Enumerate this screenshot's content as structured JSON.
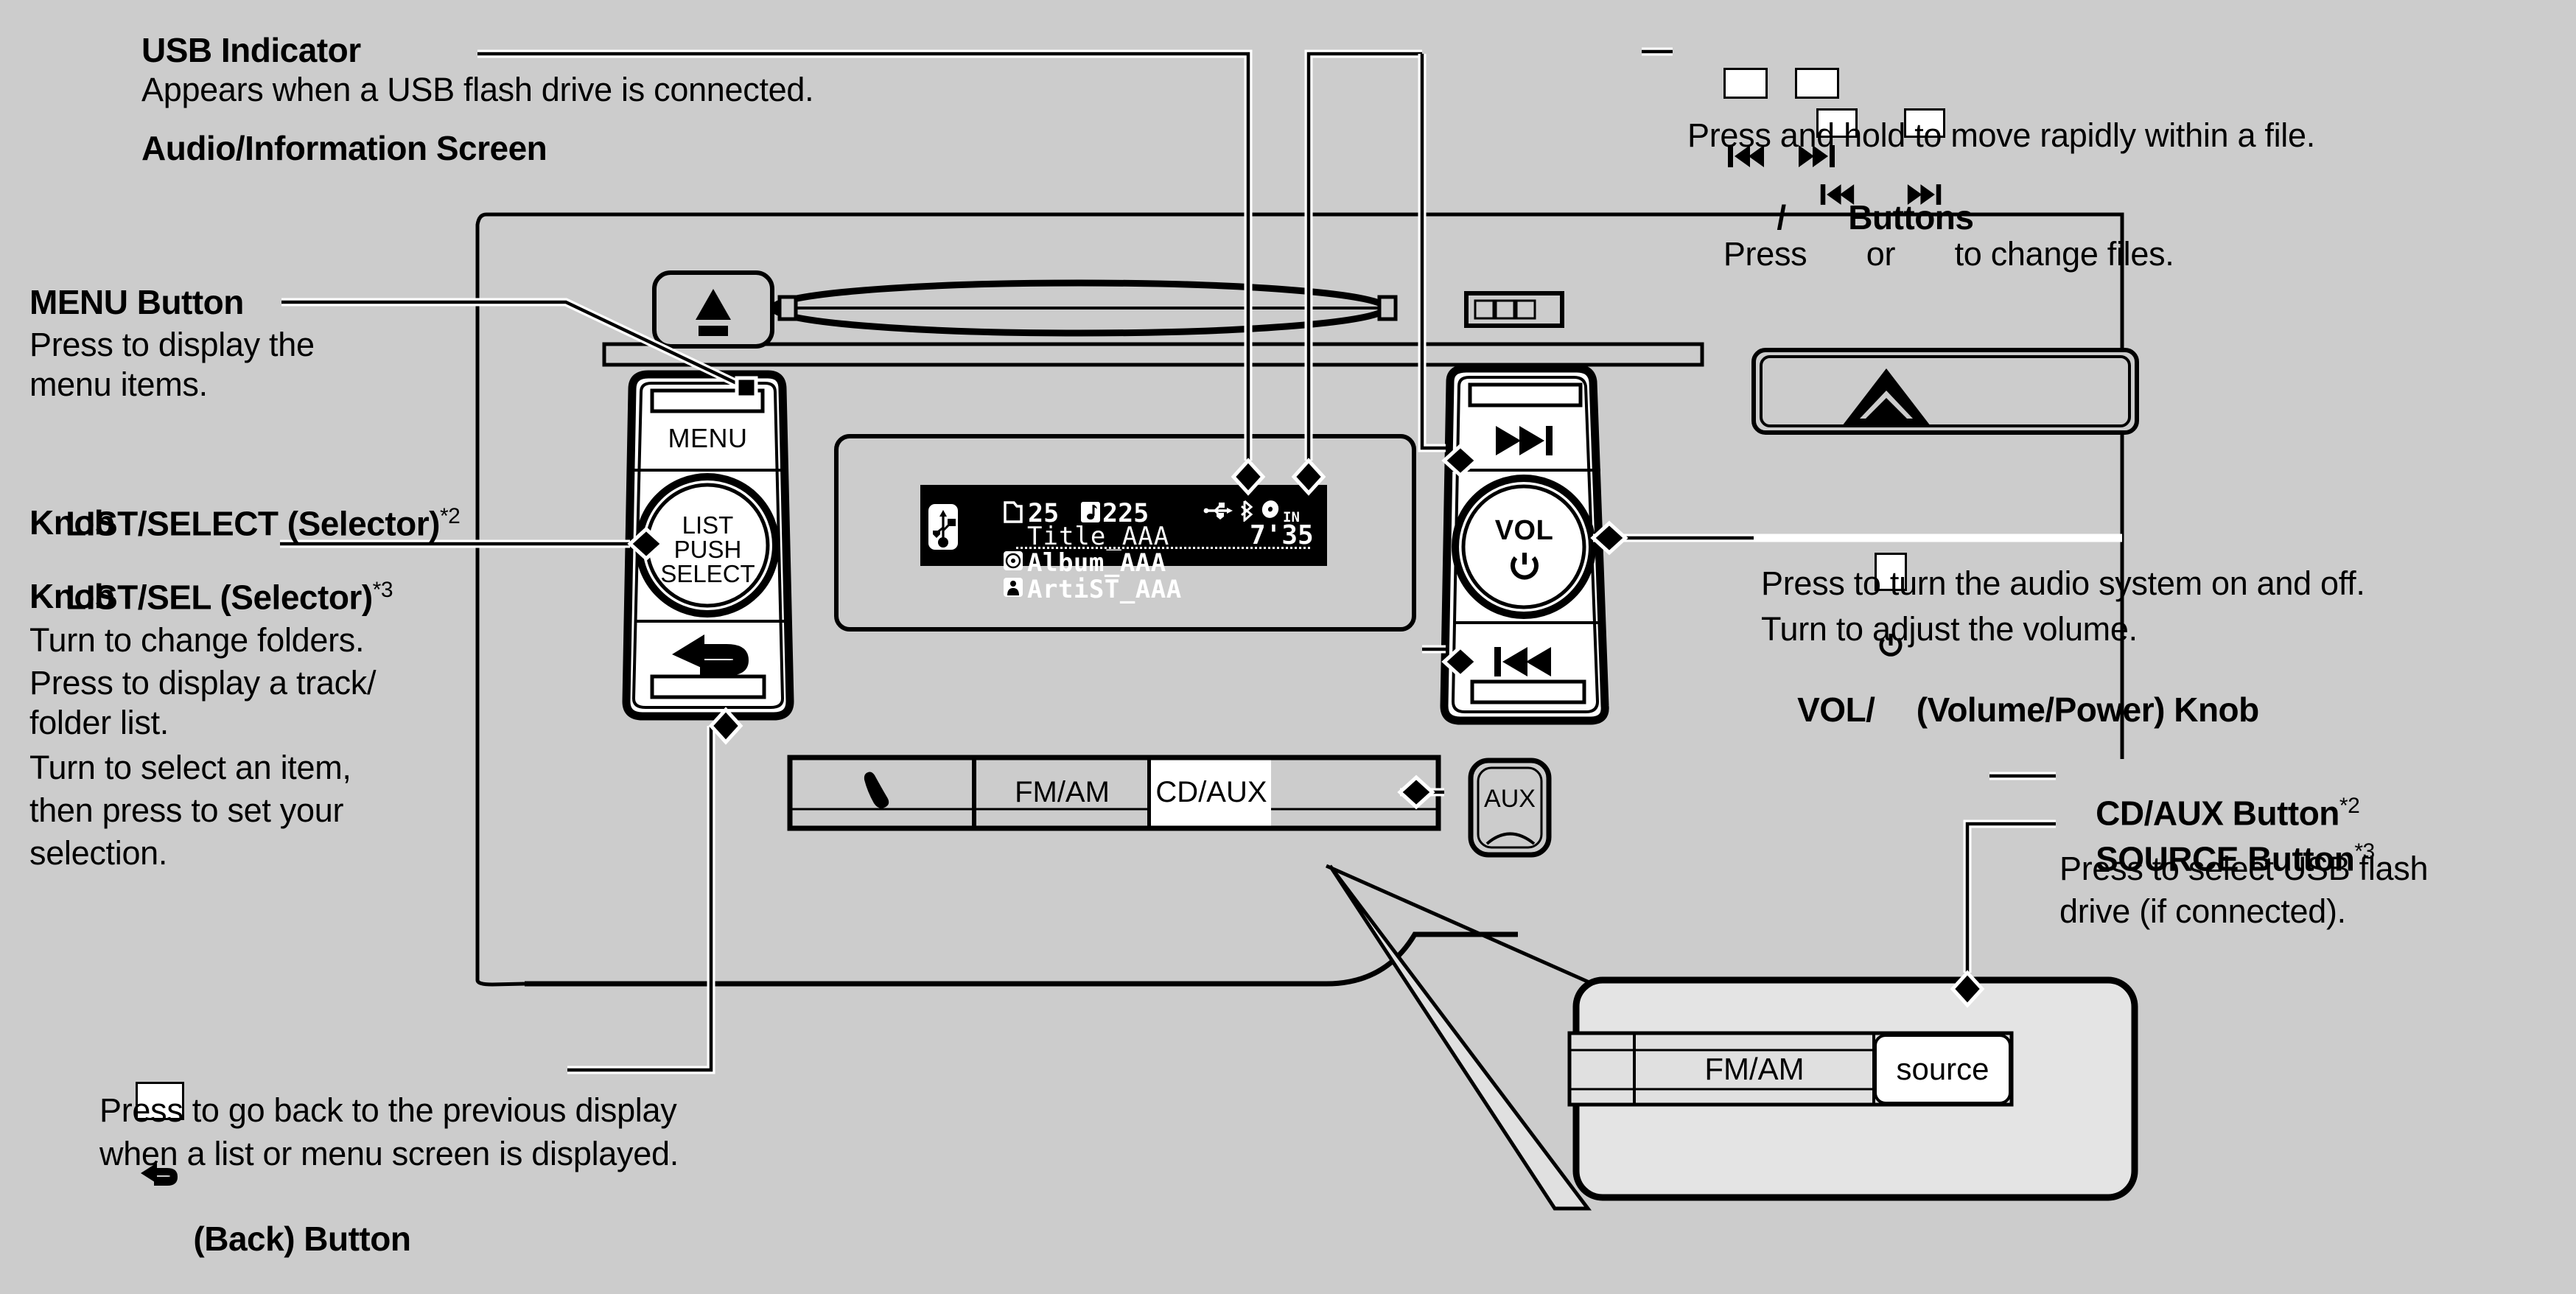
{
  "background_color": "#cccccc",
  "callouts": [
    {
      "id": "usb-indicator",
      "title": "USB Indicator",
      "lines": [
        "Appears when a USB flash drive is connected."
      ]
    },
    {
      "id": "audio-information-screen",
      "title": "Audio/Information Screen",
      "lines": []
    },
    {
      "id": "skip-buttons",
      "title_prefix": "",
      "title_mid": " / ",
      "title_suffix": " Buttons",
      "line1_a": "Press ",
      "line1_b": " or ",
      "line1_c": " to change files.",
      "line2": "Press and hold to move rapidly within a file."
    },
    {
      "id": "menu-button",
      "title": "MENU Button",
      "lines": [
        "Press to display the",
        "menu items."
      ]
    },
    {
      "id": "list-select-knob",
      "title1": "LIST/SELECT (Selector)",
      "title1_sup": "*2",
      "title1_b": "Knob",
      "title2": "LIST/SEL (Selector)",
      "title2_sup": "*3",
      "title2_b": "Knob",
      "lines": [
        "Turn to change folders.",
        "Press to display a track/",
        "folder list.",
        "Turn to select an item,",
        "then press to set your",
        "selection."
      ]
    },
    {
      "id": "back-button",
      "title_suffix": " (Back) Button",
      "lines": [
        "Press to go back to the previous display",
        "when a list or menu screen is displayed."
      ]
    },
    {
      "id": "vol-power-knob",
      "title_a": "VOL/",
      "title_b": " (Volume/Power) Knob",
      "lines": [
        "Press to turn the audio system on and off.",
        "Turn to adjust the volume."
      ]
    },
    {
      "id": "cd-aux-source-button",
      "title1": "CD/AUX Button",
      "title1_sup": "*2",
      "title2": "SOURCE Button",
      "title2_sup": "*3",
      "lines": [
        "Press to select USB flash",
        "drive (if connected)."
      ]
    }
  ],
  "head_unit": {
    "eject_button_icon": "eject-icon",
    "cd_slot": "cd-slot",
    "vent_grille": "vent-grille",
    "hazard_button_icon": "hazard-triangle-icon",
    "left_knob_panel": {
      "menu_label": "MENU",
      "knob_line1": "LIST",
      "knob_line2": "PUSH",
      "knob_line3": "SELECT",
      "back_icon": "back-arrow-icon"
    },
    "right_knob_panel": {
      "top_icon": "skip-forward-icon",
      "knob_label": "VOL",
      "knob_power_icon": "power-icon",
      "bottom_icon": "skip-back-icon"
    },
    "source_bar": {
      "buttons": [
        {
          "label": "",
          "icon": "phone-icon",
          "selected": false
        },
        {
          "label": "FM/AM",
          "icon": "",
          "selected": false
        },
        {
          "label": "CD/AUX",
          "icon": "",
          "selected": true
        }
      ]
    },
    "aux_jack_label": "AUX"
  },
  "inset_panel": {
    "buttons": [
      {
        "label": "FM/AM",
        "selected": false
      },
      {
        "label": "source",
        "selected": true
      }
    ]
  },
  "lcd": {
    "usb_indicator_icon": "usb-trident-icon",
    "folder_icon": "folder-icon",
    "folder_number": "25",
    "track_icon": "music-note-icon",
    "track_number": "225",
    "status_icons": [
      "usb-icon",
      "bluetooth-icon",
      "disc-in-icon"
    ],
    "disc_in_label": "IN",
    "title": "Title_AAA",
    "elapsed_time": "7'35",
    "album_icon": "album-icon",
    "album": "Album_AAA",
    "artist_icon": "artist-icon",
    "artist": "ArtiST_AAA"
  }
}
